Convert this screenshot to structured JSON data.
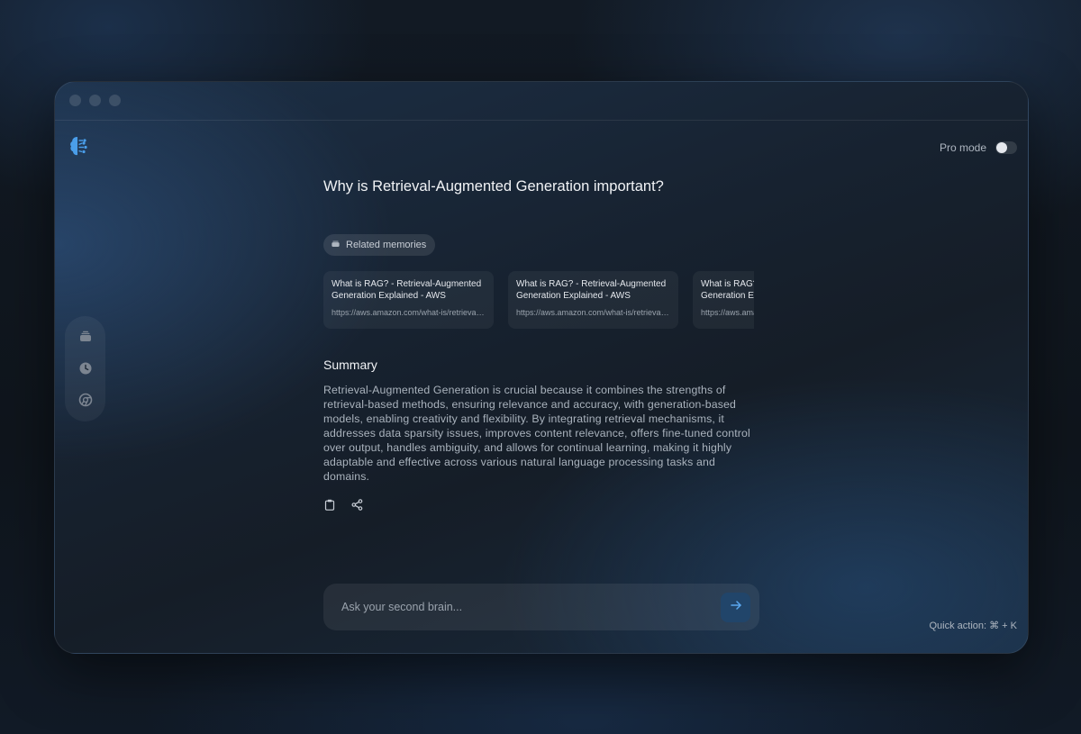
{
  "window": {
    "traffic_lights": [
      "close",
      "minimize",
      "maximize"
    ]
  },
  "logo": {
    "icon": "brain-icon",
    "color": "#4a9eea"
  },
  "pro_mode": {
    "label": "Pro mode",
    "enabled": false
  },
  "sidebar": {
    "items": [
      {
        "icon": "stack-icon",
        "name": "memories"
      },
      {
        "icon": "clock-icon",
        "name": "history"
      },
      {
        "icon": "chrome-icon",
        "name": "browser"
      }
    ]
  },
  "question": "Why is Retrieval-Augmented Generation important?",
  "related": {
    "label": "Related memories",
    "cards": [
      {
        "title": "What is RAG? - Retrieval-Augmented Generation Explained - AWS",
        "url": "https://aws.amazon.com/what-is/retrieval-augmented-generation/"
      },
      {
        "title": "What is RAG? - Retrieval-Augmented Generation Explained - AWS",
        "url": "https://aws.amazon.com/what-is/retrieval-augmented-generation/"
      },
      {
        "title": "What is RAG? - Retrieval-Augmented Generation Explained - AWS",
        "url": "https://aws.amazon.com/what-is/retrieval-augmented-generation/"
      }
    ]
  },
  "summary": {
    "title": "Summary",
    "text": "Retrieval-Augmented Generation is crucial because it combines the strengths of retrieval-based methods, ensuring relevance and accuracy, with generation-based models, enabling creativity and flexibility. By integrating retrieval mechanisms, it addresses data sparsity issues, improves content relevance, offers fine-tuned control over output, handles ambiguity, and allows for continual learning, making it highly adaptable and effective across various natural language processing tasks and domains."
  },
  "actions": [
    {
      "icon": "clipboard-icon",
      "name": "copy"
    },
    {
      "icon": "share-icon",
      "name": "share"
    }
  ],
  "composer": {
    "placeholder": "Ask your second brain...",
    "value": "",
    "send_icon": "arrow-right-icon"
  },
  "quick_action": "Quick action: ⌘ + K",
  "colors": {
    "accent": "#4a9eea",
    "send_bg": "#21456a"
  }
}
